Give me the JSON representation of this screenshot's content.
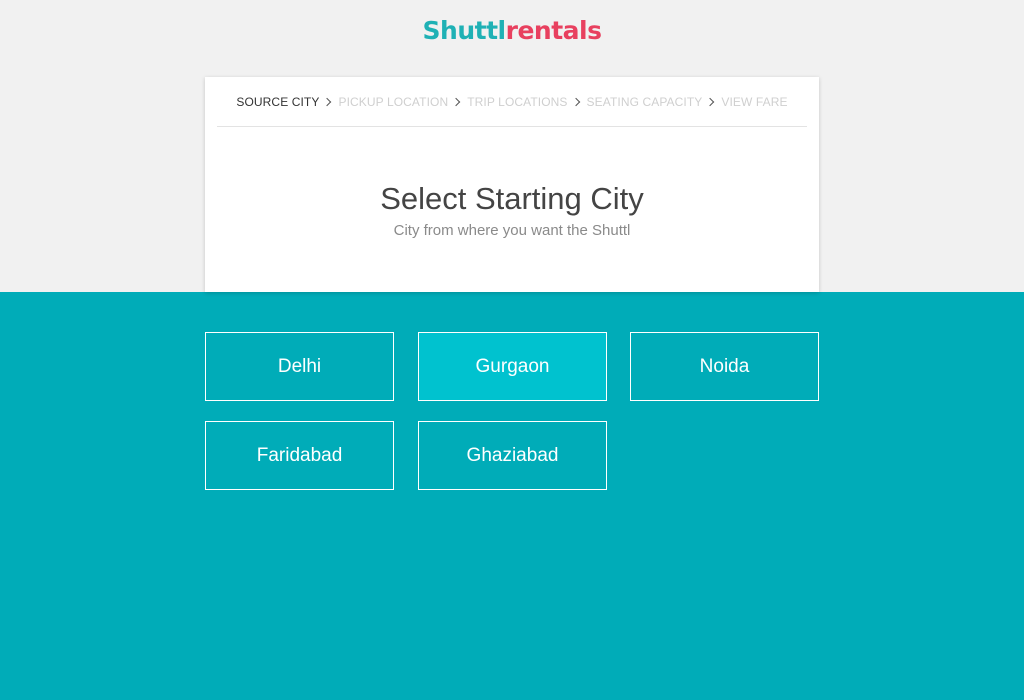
{
  "brand": {
    "logo_part1": "Shuttl",
    "logo_part2": "rentals",
    "color_part1": "#1fb1b5",
    "color_part2": "#e8405f"
  },
  "steps": [
    {
      "label": "SOURCE CITY",
      "active": true
    },
    {
      "label": "PICKUP LOCATION",
      "active": false
    },
    {
      "label": "TRIP LOCATIONS",
      "active": false
    },
    {
      "label": "SEATING CAPACITY",
      "active": false
    },
    {
      "label": "VIEW FARE",
      "active": false
    }
  ],
  "card": {
    "title": "Select Starting City",
    "subtitle": "City from where you want the Shuttl"
  },
  "cities": [
    {
      "label": "Delhi",
      "selected": false
    },
    {
      "label": "Gurgaon",
      "selected": true
    },
    {
      "label": "Noida",
      "selected": false
    },
    {
      "label": "Faridabad",
      "selected": false
    },
    {
      "label": "Ghaziabad",
      "selected": false
    }
  ],
  "colors": {
    "background_top": "#f1f1f1",
    "background_bottom": "#00acb8",
    "selected_city": "#00c2cf"
  }
}
